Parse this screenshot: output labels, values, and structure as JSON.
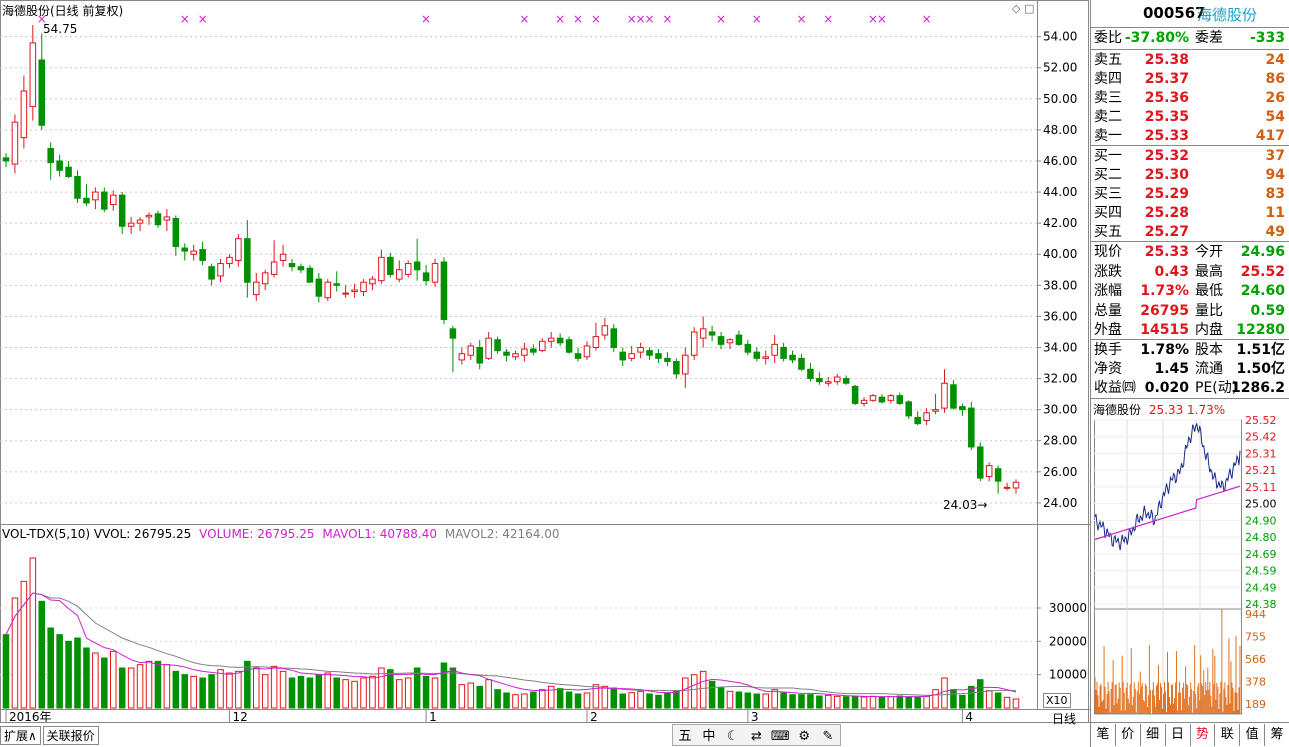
{
  "chart": {
    "header": "海德股份(日线 前复权)",
    "max_label": "54.75",
    "min_label": "24.03",
    "price_axis": [
      "54.00",
      "52.00",
      "50.00",
      "48.00",
      "46.00",
      "44.00",
      "42.00",
      "40.00",
      "38.00",
      "36.00",
      "34.00",
      "32.00",
      "30.00",
      "28.00",
      "26.00",
      "24.00"
    ],
    "volume_info": {
      "name": "VOL-TDX(5,10)",
      "vvol": "VVOL: 26795.25",
      "volume": "VOLUME: 26795.25",
      "mavol1": "MAVOL1: 40788.40",
      "mavol2": "MAVOL2: 42164.00"
    },
    "volume_axis": [
      "30000",
      "20000",
      "10000"
    ],
    "x10_label": "X10",
    "date_labels": [
      "2016年",
      "12",
      "1",
      "2",
      "3",
      "4"
    ],
    "period_label": "日线",
    "bottom_tabs": [
      "扩展∧",
      "关联报价"
    ],
    "toolbar_icons": [
      "五",
      "中",
      "moon-icon",
      "shuffle-icon",
      "keyboard-icon",
      "gear-icon",
      "wrench-icon"
    ],
    "colors": {
      "up": "#e0161d",
      "down": "#009000",
      "ma1": "#d020d0",
      "ma2": "#808080",
      "markers": "#d020d0"
    }
  },
  "chart_data": {
    "type": "candlestick",
    "ohlc": [
      [
        46.2,
        46.5,
        45.6,
        46.0
      ],
      [
        45.8,
        49.0,
        45.2,
        48.5
      ],
      [
        47.5,
        51.5,
        46.8,
        50.5
      ],
      [
        49.5,
        54.75,
        48.6,
        53.6
      ],
      [
        52.5,
        54.2,
        48.0,
        48.3
      ],
      [
        46.8,
        47.2,
        44.8,
        45.9
      ],
      [
        46.0,
        46.4,
        45.0,
        45.4
      ],
      [
        45.6,
        46.0,
        44.9,
        45.0
      ],
      [
        45.0,
        45.4,
        43.3,
        43.6
      ],
      [
        43.6,
        44.5,
        43.1,
        43.3
      ],
      [
        43.5,
        44.3,
        42.9,
        44.0
      ],
      [
        44.0,
        44.3,
        42.7,
        42.9
      ],
      [
        43.2,
        44.1,
        42.8,
        43.8
      ],
      [
        43.8,
        44.0,
        41.3,
        41.8
      ],
      [
        41.8,
        42.4,
        41.3,
        42.0
      ],
      [
        42.0,
        42.4,
        41.5,
        42.2
      ],
      [
        42.4,
        42.7,
        41.9,
        42.5
      ],
      [
        42.6,
        42.8,
        41.7,
        41.9
      ],
      [
        42.2,
        42.9,
        41.5,
        42.4
      ],
      [
        42.3,
        42.5,
        39.9,
        40.5
      ],
      [
        40.4,
        40.7,
        39.6,
        40.2
      ],
      [
        40.0,
        40.6,
        39.6,
        40.2
      ],
      [
        40.3,
        40.8,
        39.3,
        39.6
      ],
      [
        39.2,
        39.4,
        38.0,
        38.4
      ],
      [
        38.6,
        39.7,
        38.2,
        39.4
      ],
      [
        39.4,
        40.0,
        39.1,
        39.8
      ],
      [
        39.6,
        41.3,
        39.2,
        41.0
      ],
      [
        41.0,
        42.2,
        37.2,
        38.2
      ],
      [
        37.4,
        38.8,
        37.0,
        38.2
      ],
      [
        38.1,
        39.0,
        37.7,
        38.8
      ],
      [
        38.7,
        40.9,
        38.5,
        39.5
      ],
      [
        39.6,
        40.6,
        39.2,
        40.0
      ],
      [
        39.4,
        39.7,
        38.9,
        39.2
      ],
      [
        39.2,
        39.4,
        38.8,
        39.0
      ],
      [
        39.1,
        39.3,
        38.2,
        38.2
      ],
      [
        38.4,
        38.8,
        36.9,
        37.3
      ],
      [
        37.2,
        38.4,
        37.0,
        38.2
      ],
      [
        38.1,
        38.9,
        37.6,
        38.0
      ],
      [
        37.5,
        38.0,
        37.2,
        37.5
      ],
      [
        37.6,
        38.1,
        37.2,
        37.7
      ],
      [
        37.6,
        38.4,
        37.3,
        38.2
      ],
      [
        38.1,
        38.6,
        37.7,
        38.4
      ],
      [
        38.3,
        40.3,
        38.1,
        39.8
      ],
      [
        39.8,
        40.1,
        38.5,
        38.7
      ],
      [
        38.4,
        39.6,
        38.2,
        39.0
      ],
      [
        38.7,
        39.6,
        38.5,
        39.4
      ],
      [
        39.5,
        41.0,
        38.3,
        39.0
      ],
      [
        38.8,
        39.3,
        38.0,
        38.3
      ],
      [
        38.2,
        39.7,
        37.9,
        39.4
      ],
      [
        39.5,
        39.8,
        35.5,
        35.8
      ],
      [
        35.2,
        35.4,
        32.4,
        34.6
      ],
      [
        33.2,
        34.0,
        32.9,
        33.6
      ],
      [
        33.5,
        34.3,
        33.2,
        34.1
      ],
      [
        34.0,
        34.5,
        32.6,
        33.0
      ],
      [
        33.3,
        35.0,
        33.2,
        34.6
      ],
      [
        34.5,
        34.7,
        33.6,
        33.8
      ],
      [
        33.7,
        33.9,
        33.1,
        33.5
      ],
      [
        33.4,
        33.8,
        33.2,
        33.6
      ],
      [
        33.5,
        34.3,
        33.1,
        33.9
      ],
      [
        33.9,
        34.2,
        33.5,
        33.7
      ],
      [
        33.8,
        34.6,
        33.7,
        34.4
      ],
      [
        34.4,
        35.0,
        34.0,
        34.6
      ],
      [
        34.6,
        34.9,
        34.1,
        34.3
      ],
      [
        34.5,
        34.7,
        33.6,
        33.7
      ],
      [
        33.6,
        34.0,
        33.1,
        33.3
      ],
      [
        33.4,
        34.4,
        33.2,
        34.1
      ],
      [
        34.0,
        35.6,
        33.8,
        34.7
      ],
      [
        34.8,
        35.9,
        34.5,
        35.4
      ],
      [
        35.2,
        35.5,
        33.7,
        34.0
      ],
      [
        33.7,
        34.0,
        32.8,
        33.2
      ],
      [
        33.3,
        34.1,
        33.1,
        33.6
      ],
      [
        33.7,
        34.3,
        33.3,
        34.0
      ],
      [
        33.8,
        34.0,
        33.2,
        33.5
      ],
      [
        33.6,
        33.9,
        33.0,
        33.3
      ],
      [
        33.3,
        33.7,
        32.8,
        33.1
      ],
      [
        33.1,
        33.3,
        32.0,
        32.3
      ],
      [
        32.3,
        34.0,
        31.4,
        33.5
      ],
      [
        33.5,
        35.3,
        33.2,
        35.0
      ],
      [
        34.6,
        36.0,
        34.0,
        35.2
      ],
      [
        35.0,
        35.4,
        34.4,
        34.8
      ],
      [
        34.7,
        35.0,
        33.9,
        34.2
      ],
      [
        34.3,
        34.6,
        33.9,
        34.5
      ],
      [
        34.8,
        35.1,
        34.1,
        34.2
      ],
      [
        34.2,
        34.5,
        33.5,
        33.7
      ],
      [
        33.7,
        34.0,
        33.1,
        33.3
      ],
      [
        33.3,
        33.8,
        32.9,
        33.4
      ],
      [
        33.5,
        34.8,
        33.0,
        34.2
      ],
      [
        34.0,
        34.3,
        33.1,
        33.3
      ],
      [
        33.5,
        33.8,
        33.0,
        33.2
      ],
      [
        33.3,
        33.6,
        32.5,
        32.6
      ],
      [
        32.6,
        33.0,
        31.8,
        32.0
      ],
      [
        32.0,
        32.4,
        31.6,
        31.8
      ],
      [
        31.7,
        32.1,
        31.5,
        31.8
      ],
      [
        31.8,
        32.3,
        31.6,
        32.1
      ],
      [
        32.0,
        32.2,
        31.6,
        31.7
      ],
      [
        31.5,
        31.6,
        30.3,
        30.4
      ],
      [
        30.4,
        30.8,
        30.2,
        30.6
      ],
      [
        30.6,
        31.0,
        30.5,
        30.9
      ],
      [
        30.8,
        31.0,
        30.4,
        30.5
      ],
      [
        30.6,
        31.0,
        30.4,
        30.9
      ],
      [
        30.9,
        31.1,
        30.3,
        30.4
      ],
      [
        30.5,
        30.6,
        29.4,
        29.6
      ],
      [
        29.5,
        29.9,
        29.0,
        29.1
      ],
      [
        29.3,
        30.1,
        29.0,
        29.8
      ],
      [
        29.9,
        31.0,
        29.7,
        30.0
      ],
      [
        30.1,
        32.6,
        29.8,
        31.7
      ],
      [
        31.6,
        31.9,
        30.0,
        30.1
      ],
      [
        30.2,
        30.4,
        29.6,
        30.0
      ],
      [
        30.1,
        30.5,
        27.4,
        27.6
      ],
      [
        27.6,
        27.9,
        25.4,
        25.6
      ],
      [
        25.7,
        26.6,
        25.4,
        26.4
      ],
      [
        26.2,
        26.4,
        24.6,
        25.4
      ],
      [
        25.0,
        25.3,
        24.8,
        25.0
      ],
      [
        24.96,
        25.52,
        24.6,
        25.33
      ]
    ],
    "volume": [
      22000,
      33000,
      38000,
      45000,
      32000,
      24000,
      22000,
      20000,
      21000,
      18000,
      16500,
      15000,
      17000,
      12000,
      12000,
      13000,
      14000,
      14000,
      13000,
      11000,
      10000,
      9500,
      9000,
      10000,
      11500,
      10500,
      11000,
      14000,
      12000,
      10000,
      12500,
      11000,
      9000,
      9500,
      9000,
      10000,
      10500,
      9000,
      8500,
      8000,
      9000,
      9500,
      12000,
      11500,
      8500,
      9000,
      12000,
      9500,
      9000,
      13500,
      12000,
      7000,
      7500,
      6500,
      8500,
      5500,
      4500,
      4000,
      4200,
      4800,
      5500,
      6500,
      5800,
      4800,
      4200,
      4500,
      7000,
      6500,
      6000,
      4200,
      4600,
      5000,
      4200,
      3800,
      4400,
      5200,
      9000,
      10000,
      11000,
      8000,
      6000,
      5000,
      4800,
      4500,
      4200,
      4200,
      5500,
      4500,
      4000,
      4000,
      4000,
      3600,
      3800,
      3500,
      3400,
      3500,
      3300,
      3500,
      3300,
      3400,
      3600,
      3300,
      3200,
      3500,
      5500,
      9000,
      5500,
      3800,
      6500,
      8500,
      5200,
      4500,
      3200,
      2700
    ],
    "mavol1": [
      22000,
      27500,
      31000,
      34500,
      34000,
      32400,
      32200,
      29800,
      27800,
      21000,
      19500,
      18100,
      17500,
      15900,
      14500,
      13600,
      13800,
      13000,
      13000,
      12800,
      12300,
      11500,
      11000,
      10700,
      10400,
      10100,
      10500,
      11500,
      11800,
      11700,
      12000,
      11900,
      11300,
      10500,
      10300,
      10100,
      10000,
      9900,
      9700,
      9400,
      9400,
      9000,
      9400,
      10000,
      10100,
      10100,
      10300,
      10100,
      10000,
      10700,
      11200,
      10500,
      10000,
      9700,
      8600,
      7800,
      7000,
      6200,
      5600,
      5300,
      5200,
      5400,
      5600,
      5600,
      5400,
      5600,
      5900,
      6000,
      5800,
      5800,
      5700,
      5500,
      5100,
      4700,
      4600,
      4700,
      5700,
      6900,
      8000,
      8600,
      8400,
      8000,
      7600,
      6900,
      5800,
      5000,
      5000,
      4800,
      4600,
      4400,
      4400,
      4300,
      4100,
      3900,
      3700,
      3600,
      3500,
      3400,
      3400,
      3400,
      3400,
      3400,
      3400,
      3500,
      4000,
      5000,
      5500,
      5400,
      5800,
      6200,
      6200,
      6100,
      5500,
      4800
    ],
    "mavol2": [
      22000,
      27500,
      31000,
      34500,
      34000,
      33000,
      33000,
      32000,
      30500,
      28000,
      25500,
      24000,
      22500,
      21000,
      20000,
      19000,
      18200,
      17200,
      16300,
      15500,
      14500,
      13600,
      13000,
      12700,
      12600,
      12300,
      12200,
      12300,
      12400,
      12300,
      12200,
      12000,
      11900,
      11700,
      11600,
      11300,
      11000,
      10900,
      10700,
      10500,
      10400,
      10200,
      10300,
      10400,
      10400,
      10500,
      10500,
      10400,
      10300,
      10500,
      10500,
      10300,
      10100,
      9900,
      9700,
      9600,
      9200,
      8800,
      8400,
      8100,
      7700,
      7400,
      7100,
      6900,
      6700,
      6400,
      6400,
      6100,
      5900,
      5600,
      5400,
      5300,
      5300,
      5300,
      5200,
      5200,
      5300,
      5600,
      5900,
      6100,
      6300,
      6400,
      6500,
      6400,
      6100,
      6000,
      6000,
      6000,
      6000,
      5700,
      5600,
      5100,
      4800,
      4500,
      4300,
      4300,
      4300,
      4300,
      4300,
      4200,
      4100,
      4000,
      3900,
      3800,
      3900,
      4000,
      4200,
      4300,
      4500,
      4800,
      5100,
      5300,
      5300,
      5200
    ],
    "intraday_y_range": [
      24.38,
      25.52
    ],
    "xlabel": "",
    "ylabel": ""
  },
  "quote": {
    "code": "000567",
    "name": "海德股份",
    "weibi_label": "委比",
    "weibi_value": "-37.80%",
    "weicha_label": "委差",
    "weicha_value": "-333",
    "sell": [
      {
        "label": "卖五",
        "price": "25.38",
        "vol": "24"
      },
      {
        "label": "卖四",
        "price": "25.37",
        "vol": "86"
      },
      {
        "label": "卖三",
        "price": "25.36",
        "vol": "26"
      },
      {
        "label": "卖二",
        "price": "25.35",
        "vol": "54"
      },
      {
        "label": "卖一",
        "price": "25.33",
        "vol": "417"
      }
    ],
    "buy": [
      {
        "label": "买一",
        "price": "25.32",
        "vol": "37"
      },
      {
        "label": "买二",
        "price": "25.30",
        "vol": "94"
      },
      {
        "label": "买三",
        "price": "25.29",
        "vol": "83"
      },
      {
        "label": "买四",
        "price": "25.28",
        "vol": "11"
      },
      {
        "label": "买五",
        "price": "25.27",
        "vol": "49"
      }
    ],
    "stats": [
      {
        "l1": "现价",
        "v1": "25.33",
        "c1": "red",
        "l2": "今开",
        "v2": "24.96",
        "c2": "green"
      },
      {
        "l1": "涨跌",
        "v1": "0.43",
        "c1": "red",
        "l2": "最高",
        "v2": "25.52",
        "c2": "red"
      },
      {
        "l1": "涨幅",
        "v1": "1.73%",
        "c1": "red",
        "l2": "最低",
        "v2": "24.60",
        "c2": "green"
      },
      {
        "l1": "总量",
        "v1": "26795",
        "c1": "red",
        "l2": "量比",
        "v2": "0.59",
        "c2": "green"
      },
      {
        "l1": "外盘",
        "v1": "14515",
        "c1": "red",
        "l2": "内盘",
        "v2": "12280",
        "c2": "green"
      }
    ],
    "finance": [
      {
        "l1": "换手",
        "v1": "1.78%",
        "l2": "股本",
        "v2": "1.51亿"
      },
      {
        "l1": "净资",
        "v1": "1.45",
        "l2": "流通",
        "v2": "1.50亿"
      },
      {
        "l1": "收益㈣",
        "v1": "0.020",
        "l2": "PE(动)",
        "v2": "1286.2"
      }
    ],
    "mini_title": "海德股份",
    "mini_price": "25.33",
    "mini_pct": "1.73%",
    "mini_price_axis": [
      "25.52",
      "25.42",
      "25.31",
      "25.21",
      "25.11",
      "25.00",
      "24.90",
      "24.80",
      "24.69",
      "24.59",
      "24.49",
      "24.38"
    ],
    "mini_vol_axis": [
      "944",
      "755",
      "566",
      "378",
      "189"
    ],
    "bottom_tabs": [
      "笔",
      "价",
      "细",
      "日",
      "势",
      "联",
      "值",
      "筹"
    ],
    "active_tab": "势"
  }
}
